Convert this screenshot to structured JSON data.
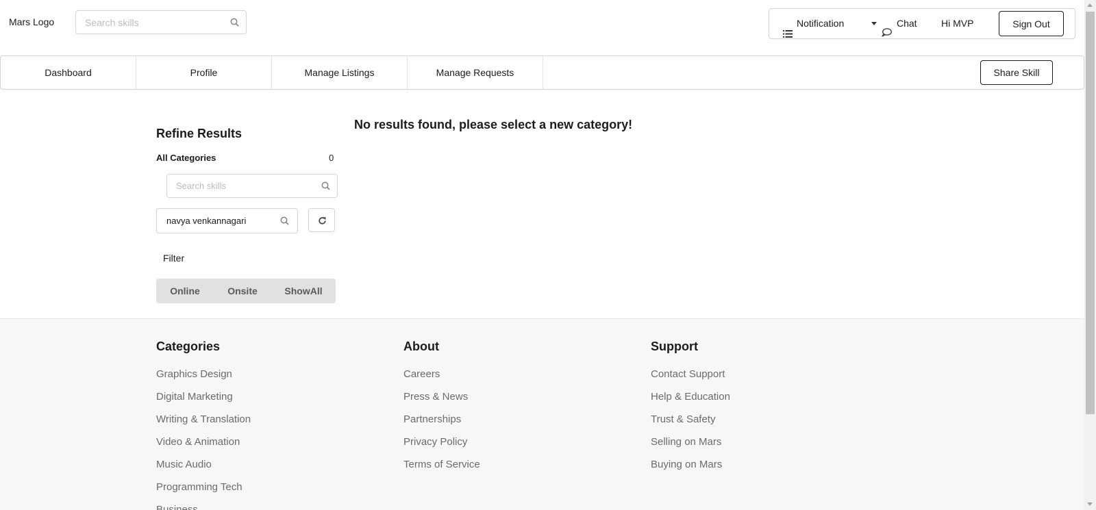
{
  "header": {
    "logo": "Mars Logo",
    "search_placeholder": "Search skills",
    "notification_label": "Notification",
    "chat_label": "Chat",
    "greeting": "Hi MVP",
    "sign_out_label": "Sign Out"
  },
  "nav": {
    "items": [
      "Dashboard",
      "Profile",
      "Manage Listings",
      "Manage Requests"
    ],
    "share_skill_label": "Share Skill"
  },
  "refine": {
    "title": "Refine Results",
    "all_categories_label": "All Categories",
    "all_categories_count": "0",
    "skill_search_placeholder": "Search skills",
    "user_search_value": "navya venkannagari",
    "filter_label": "Filter",
    "filter_options": [
      "Online",
      "Onsite",
      "ShowAll"
    ]
  },
  "main": {
    "no_results_text": "No results found, please select a new category!"
  },
  "footer": {
    "categories": {
      "title": "Categories",
      "links": [
        "Graphics Design",
        "Digital Marketing",
        "Writing & Translation",
        "Video & Animation",
        "Music Audio",
        "Programming Tech",
        "Business"
      ]
    },
    "about": {
      "title": "About",
      "links": [
        "Careers",
        "Press & News",
        "Partnerships",
        "Privacy Policy",
        "Terms of Service"
      ]
    },
    "support": {
      "title": "Support",
      "links": [
        "Contact Support",
        "Help & Education",
        "Trust & Safety",
        "Selling on Mars",
        "Buying on Mars"
      ]
    }
  },
  "icons": {
    "search": "search-icon",
    "list": "list-icon",
    "caret": "caret-down-icon",
    "chat": "chat-bubble-icon",
    "refresh": "refresh-icon"
  }
}
